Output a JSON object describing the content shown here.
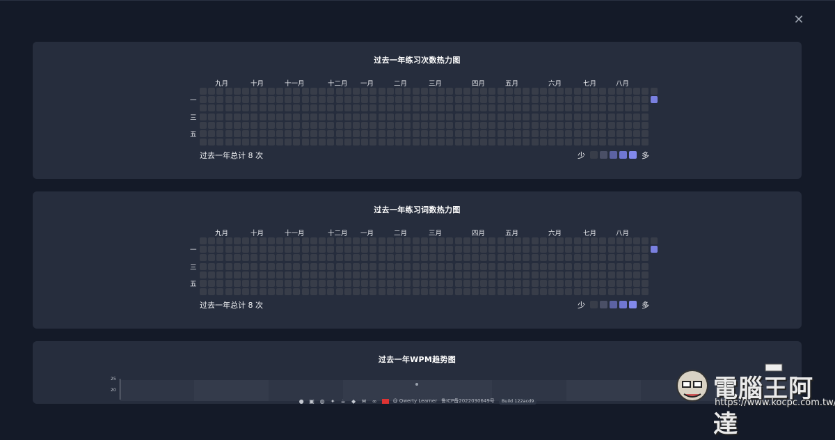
{
  "cards": [
    {
      "title": "过去一年练习次数热力图",
      "total": "过去一年总计 8 次",
      "legend_less": "少",
      "legend_more": "多",
      "active_cell": {
        "week": 53,
        "weekday": 1
      }
    },
    {
      "title": "过去一年练习词数热力图",
      "total": "过去一年总计 8 次",
      "legend_less": "少",
      "legend_more": "多",
      "active_cell": {
        "week": 53,
        "weekday": 1
      }
    }
  ],
  "months": [
    "九月",
    "十月",
    "十一月",
    "十二月",
    "一月",
    "二月",
    "三月",
    "四月",
    "五月",
    "六月",
    "七月",
    "八月"
  ],
  "weekday_labels": [
    "一",
    "三",
    "五"
  ],
  "legend_colors": [
    "#383d49",
    "#4a4f66",
    "#5c62a3",
    "#7077d2",
    "#8289ec"
  ],
  "active_color": "#7a80e0",
  "wpm": {
    "title": "过去一年WPM趋势图",
    "y_ticks": [
      "25",
      "20"
    ]
  },
  "footer": {
    "author": "@ Qwerty Learner",
    "icp": "鲁ICP备2022030649号",
    "build": "Build 122acd9"
  },
  "watermark": {
    "name": "電腦王阿達",
    "url": "https://www.kocpc.com.tw/"
  }
}
